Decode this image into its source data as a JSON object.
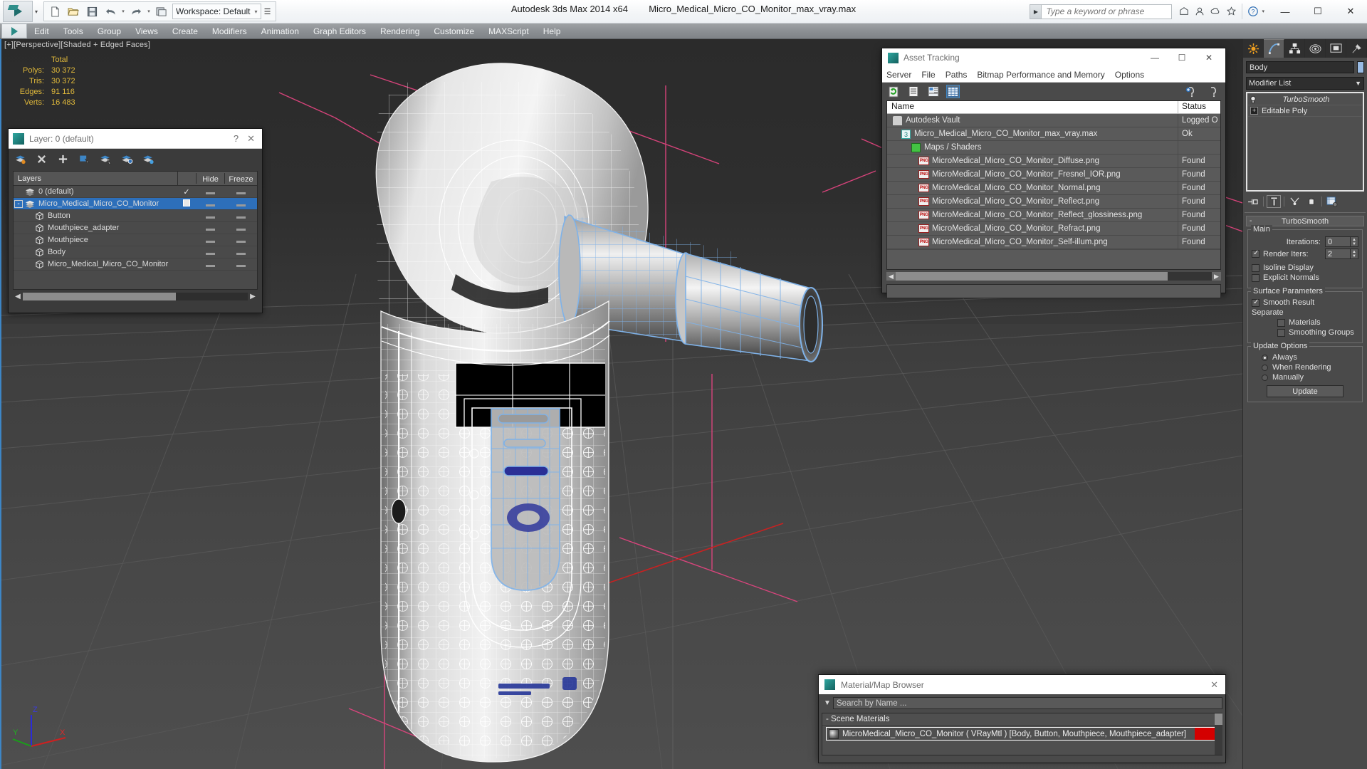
{
  "titlebar": {
    "workspace_label": "Workspace: Default",
    "app_title": "Autodesk 3ds Max  2014 x64",
    "file_title": "Micro_Medical_Micro_CO_Monitor_max_vray.max",
    "search_placeholder": "Type a keyword or phrase",
    "minimize": "—",
    "maximize": "☐",
    "close": "✕",
    "help": "?"
  },
  "menubar": {
    "items": [
      "Edit",
      "Tools",
      "Group",
      "Views",
      "Create",
      "Modifiers",
      "Animation",
      "Graph Editors",
      "Rendering",
      "Customize",
      "MAXScript",
      "Help"
    ]
  },
  "viewport": {
    "label": "[+][Perspective][Shaded + Edged Faces]",
    "stats": {
      "header": "Total",
      "rows": [
        {
          "label": "Polys:",
          "value": "30 372"
        },
        {
          "label": "Tris:",
          "value": "30 372"
        },
        {
          "label": "Edges:",
          "value": "91 116"
        },
        {
          "label": "Verts:",
          "value": "16 483"
        }
      ]
    },
    "axes": {
      "x": "X",
      "y": "Y",
      "z": "Z"
    }
  },
  "layer_dialog": {
    "title": "Layer: 0 (default)",
    "help": "?",
    "close": "✕",
    "columns": {
      "name": "Layers",
      "hide": "Hide",
      "freeze": "Freeze"
    },
    "rows": [
      {
        "name": "0 (default)",
        "indent": 0,
        "type": "layer",
        "selected": false,
        "check": "✓",
        "expander": ""
      },
      {
        "name": "Micro_Medical_Micro_CO_Monitor",
        "indent": 0,
        "type": "layer",
        "selected": true,
        "check": "",
        "expander": "-"
      },
      {
        "name": "Button",
        "indent": 1,
        "type": "object",
        "selected": false,
        "check": "",
        "expander": ""
      },
      {
        "name": "Mouthpiece_adapter",
        "indent": 1,
        "type": "object",
        "selected": false,
        "check": "",
        "expander": ""
      },
      {
        "name": "Mouthpiece",
        "indent": 1,
        "type": "object",
        "selected": false,
        "check": "",
        "expander": ""
      },
      {
        "name": "Body",
        "indent": 1,
        "type": "object",
        "selected": false,
        "check": "",
        "expander": ""
      },
      {
        "name": "Micro_Medical_Micro_CO_Monitor",
        "indent": 1,
        "type": "object",
        "selected": false,
        "check": "",
        "expander": ""
      }
    ]
  },
  "asset_tracking": {
    "title": "Asset Tracking",
    "minimize": "—",
    "maximize": "☐",
    "close": "✕",
    "menu": [
      "Server",
      "File",
      "Paths",
      "Bitmap Performance and Memory",
      "Options"
    ],
    "columns": {
      "name": "Name",
      "status": "Status"
    },
    "rows": [
      {
        "name": "Autodesk Vault",
        "status": "Logged O",
        "indent": 0,
        "icon": "vault-icon"
      },
      {
        "name": "Micro_Medical_Micro_CO_Monitor_max_vray.max",
        "status": "Ok",
        "indent": 1,
        "icon": "max-file-icon"
      },
      {
        "name": "Maps / Shaders",
        "status": "",
        "indent": 2,
        "icon": "maps-shaders-icon"
      },
      {
        "name": "MicroMedical_Micro_CO_Monitor_Diffuse.png",
        "status": "Found",
        "indent": 3,
        "icon": "png-icon"
      },
      {
        "name": "MicroMedical_Micro_CO_Monitor_Fresnel_IOR.png",
        "status": "Found",
        "indent": 3,
        "icon": "png-icon"
      },
      {
        "name": "MicroMedical_Micro_CO_Monitor_Normal.png",
        "status": "Found",
        "indent": 3,
        "icon": "png-icon"
      },
      {
        "name": "MicroMedical_Micro_CO_Monitor_Reflect.png",
        "status": "Found",
        "indent": 3,
        "icon": "png-icon"
      },
      {
        "name": "MicroMedical_Micro_CO_Monitor_Reflect_glossiness.png",
        "status": "Found",
        "indent": 3,
        "icon": "png-icon"
      },
      {
        "name": "MicroMedical_Micro_CO_Monitor_Refract.png",
        "status": "Found",
        "indent": 3,
        "icon": "png-icon"
      },
      {
        "name": "MicroMedical_Micro_CO_Monitor_Self-illum.png",
        "status": "Found",
        "indent": 3,
        "icon": "png-icon"
      }
    ]
  },
  "command_panel": {
    "object_name": "Body",
    "object_color": "#99bbe4",
    "modifier_list_label": "Modifier List",
    "stack": [
      {
        "label": "TurboSmooth",
        "italic": true
      },
      {
        "label": "Editable Poly",
        "italic": false
      }
    ],
    "turbosmooth": {
      "rollout_title": "TurboSmooth",
      "main_label": "Main",
      "iterations_label": "Iterations:",
      "iterations_value": "0",
      "render_iters_label": "Render Iters:",
      "render_iters_value": "2",
      "render_iters_checked": true,
      "isoline_label": "Isoline Display",
      "isoline_checked": false,
      "explicit_label": "Explicit Normals",
      "explicit_checked": false,
      "surface_label": "Surface Parameters",
      "smooth_result_label": "Smooth Result",
      "smooth_result_checked": true,
      "separate_label": "Separate",
      "materials_label": "Materials",
      "materials_checked": false,
      "smoothing_groups_label": "Smoothing Groups",
      "smoothing_groups_checked": false,
      "update_options_label": "Update Options",
      "always_label": "Always",
      "when_rendering_label": "When Rendering",
      "manually_label": "Manually",
      "selected_update": "Always",
      "update_button": "Update"
    }
  },
  "material_browser": {
    "title": "Material/Map Browser",
    "close": "✕",
    "search_placeholder": "Search by Name ...",
    "group_label": "- Scene Materials",
    "item": "MicroMedical_Micro_CO_Monitor ( VRayMtl ) [Body, Button, Mouthpiece, Mouthpiece_adapter]"
  },
  "colors": {
    "accent_blue": "#3d86c6",
    "selection_blue": "#2d6fba",
    "stat_yellow": "#e0b93b",
    "panel_gray": "#4a4a4a",
    "viewport_gray": "#3f3f3f",
    "wire_white": "#f2f2f2",
    "wire_selected": "#7fb2e8",
    "grid_pink": "#e0457f",
    "red_tag": "#d40000"
  }
}
